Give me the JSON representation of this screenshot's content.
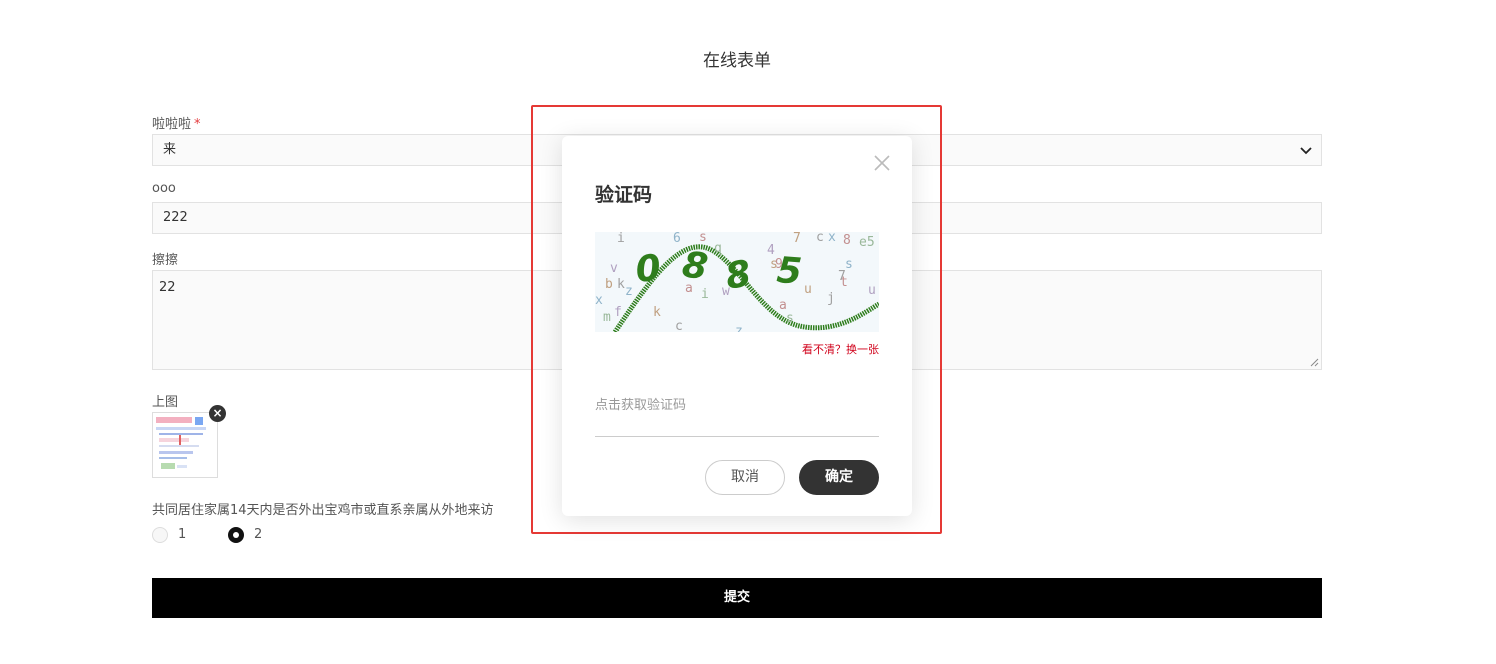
{
  "page": {
    "title": "在线表单"
  },
  "form": {
    "field1": {
      "label": "啦啦啦",
      "required_mark": "*",
      "value": "来"
    },
    "field2": {
      "label": "ooo",
      "value": "222"
    },
    "field3": {
      "label": "擦擦",
      "value": "22"
    },
    "field4": {
      "label": "上图",
      "remove_symbol": "×"
    },
    "field5": {
      "label": "共同居住家属14天内是否外出宝鸡市或直系亲属从外地来访",
      "options": [
        "1",
        "2"
      ],
      "selected": "2"
    },
    "submit_label": "提交"
  },
  "modal": {
    "title": "验证码",
    "captcha": {
      "code": [
        "0",
        "8",
        "8",
        "5"
      ],
      "code_color": "#2e7d1c",
      "noise_chars": [
        "i",
        "6",
        "s",
        "q",
        "4",
        "7",
        "c",
        "x",
        "8",
        "e5",
        "v",
        "b",
        "k",
        "z",
        "a",
        "i",
        "w",
        "u",
        "j",
        "s",
        "t",
        "m",
        "f",
        "k",
        "c",
        "z",
        "a",
        "s",
        "u",
        "s",
        "7",
        "x",
        "9"
      ]
    },
    "refresh_label": "看不清？换一张",
    "input_placeholder": "点击获取验证码",
    "cancel_label": "取消",
    "confirm_label": "确定"
  },
  "colors": {
    "highlight": "#e53935",
    "required": "#e4393c",
    "link": "#d0021b"
  }
}
